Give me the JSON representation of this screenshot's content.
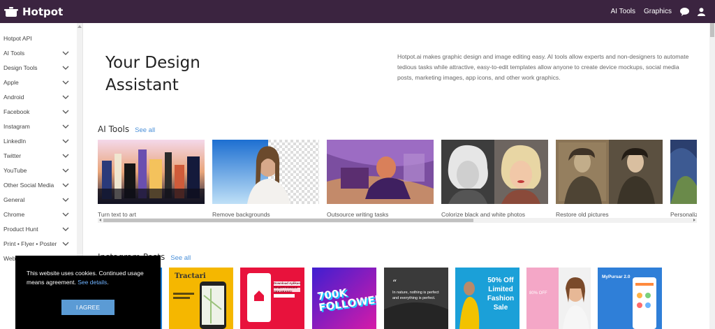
{
  "app": {
    "name": "Hotpot"
  },
  "topnav": {
    "ai_tools": "AI Tools",
    "graphics": "Graphics",
    "chat_icon": "chat-icon",
    "user_icon": "user-icon"
  },
  "sidebar": {
    "items": [
      {
        "label": "Hotpot API",
        "expandable": false
      },
      {
        "label": "AI Tools",
        "expandable": true
      },
      {
        "label": "Design Tools",
        "expandable": true
      },
      {
        "label": "Apple",
        "expandable": true
      },
      {
        "label": "Android",
        "expandable": true
      },
      {
        "label": "Facebook",
        "expandable": true
      },
      {
        "label": "Instagram",
        "expandable": true
      },
      {
        "label": "LinkedIn",
        "expandable": true
      },
      {
        "label": "Twitter",
        "expandable": true
      },
      {
        "label": "YouTube",
        "expandable": true
      },
      {
        "label": "Other Social Media",
        "expandable": true
      },
      {
        "label": "General",
        "expandable": true
      },
      {
        "label": "Chrome",
        "expandable": true
      },
      {
        "label": "Product Hunt",
        "expandable": true
      },
      {
        "label": "Print • Flyer • Poster",
        "expandable": true
      },
      {
        "label": "Web",
        "expandable": false
      }
    ]
  },
  "hero": {
    "title": "Your Design Assistant",
    "description": "Hotpot.ai makes graphic design and image editing easy. AI tools allow experts and non-designers to automate tedious tasks while attractive, easy-to-edit templates allow anyone to create device mockups, social media posts, marketing images, app icons, and other work graphics."
  },
  "ai_tools": {
    "heading": "AI Tools",
    "see_all": "See all",
    "items": [
      {
        "label": "Turn text to art"
      },
      {
        "label": "Remove backgrounds"
      },
      {
        "label": "Outsource writing tasks"
      },
      {
        "label": "Colorize black and white photos"
      },
      {
        "label": "Restore old pictures"
      },
      {
        "label": "Personalize"
      }
    ]
  },
  "instagram": {
    "heading": "Instagram Posts",
    "see_all": "See all",
    "posts": [
      {
        "text": ""
      },
      {
        "text": "Tractari"
      },
      {
        "text": "Download Aplikasi SmartFrenHome SEKARANG!"
      },
      {
        "text": "700K FOLLOWERS"
      },
      {
        "text": "In nature, nothing is perfect and everything is perfect."
      },
      {
        "text": "50% Off Limited Fashion Sale"
      },
      {
        "text": "80% OFF"
      },
      {
        "text": "MyPursar 2.0"
      }
    ]
  },
  "cookie": {
    "message": "This website uses cookies. Continued usage means agreement.",
    "link": "See details",
    "button": "I AGREE"
  }
}
